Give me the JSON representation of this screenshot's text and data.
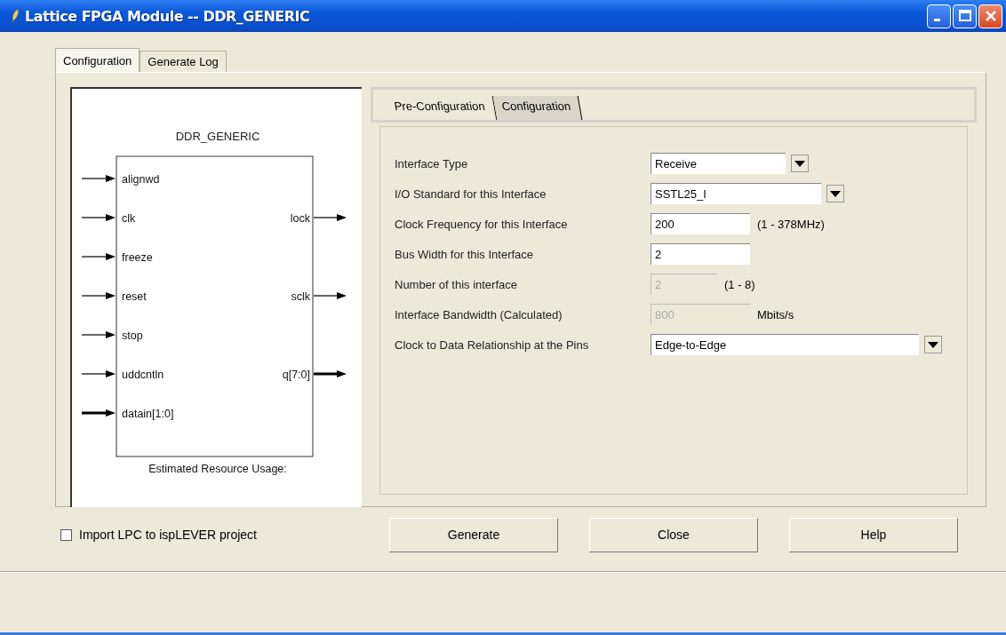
{
  "window": {
    "title": "Lattice FPGA Module -- DDR_GENERIC"
  },
  "tabs": [
    {
      "label": "Configuration",
      "selected": true
    },
    {
      "label": "Generate Log",
      "selected": false
    }
  ],
  "diagram": {
    "title": "DDR_GENERIC",
    "footer": "Estimated Resource Usage:",
    "inputs": [
      {
        "name": "alignwd",
        "bus": false
      },
      {
        "name": "clk",
        "bus": false
      },
      {
        "name": "freeze",
        "bus": false
      },
      {
        "name": "reset",
        "bus": false
      },
      {
        "name": "stop",
        "bus": false
      },
      {
        "name": "uddcntln",
        "bus": false
      },
      {
        "name": "datain[1:0]",
        "bus": true
      }
    ],
    "outputs": [
      {
        "name": "lock",
        "bus": false
      },
      {
        "name": "sclk",
        "bus": false
      },
      {
        "name": "q[7:0]",
        "bus": true
      }
    ]
  },
  "subtabs": [
    {
      "label": "Pre-Configuration",
      "selected": true
    },
    {
      "label": "Configuration",
      "selected": false
    }
  ],
  "fields": [
    {
      "label": "Interface Type",
      "kind": "dropdown",
      "value": "Receive",
      "disabled": false
    },
    {
      "label": "I/O Standard for this Interface",
      "kind": "dropdown",
      "value": "SSTL25_I",
      "disabled": false
    },
    {
      "label": "Clock Frequency for this Interface",
      "kind": "input",
      "value": "200",
      "unit": "(1 - 378MHz)",
      "disabled": false
    },
    {
      "label": "Bus Width for this Interface",
      "kind": "input",
      "value": "2",
      "disabled": false
    },
    {
      "label": "Number of this interface",
      "kind": "input",
      "value": "2",
      "unit": "(1 - 8)",
      "disabled": true
    },
    {
      "label": "Interface Bandwidth (Calculated)",
      "kind": "input",
      "value": "800",
      "unit": "Mbits/s",
      "disabled": true
    },
    {
      "label": "Clock to Data Relationship at the Pins",
      "kind": "dropdown",
      "value": "Edge-to-Edge",
      "disabled": false
    }
  ],
  "import_checkbox": {
    "label": "Import LPC to ispLEVER project",
    "checked": false
  },
  "buttons": [
    "Generate",
    "Close",
    "Help"
  ]
}
